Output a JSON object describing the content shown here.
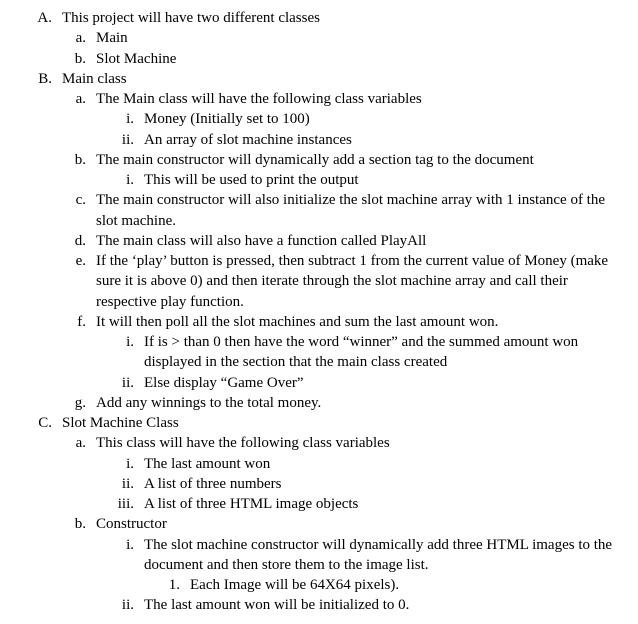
{
  "items": [
    {
      "level": 0,
      "marker": "A.",
      "text": "This project will have two different classes"
    },
    {
      "level": 1,
      "marker": "a.",
      "text": "Main"
    },
    {
      "level": 1,
      "marker": "b.",
      "text": "Slot Machine"
    },
    {
      "level": 0,
      "marker": "B.",
      "text": "Main class"
    },
    {
      "level": 1,
      "marker": "a.",
      "text": "The Main class will have the following class variables"
    },
    {
      "level": 2,
      "marker": "i.",
      "text": "Money (Initially set to 100)"
    },
    {
      "level": 2,
      "marker": "ii.",
      "text": "An array of slot machine instances"
    },
    {
      "level": 1,
      "marker": "b.",
      "text": "The main constructor will dynamically add a section tag to the document"
    },
    {
      "level": 2,
      "marker": "i.",
      "text": "This will be used to print the output"
    },
    {
      "level": 1,
      "marker": "c.",
      "text": "The main constructor will also initialize the slot machine array with 1 instance of the slot machine."
    },
    {
      "level": 1,
      "marker": "d.",
      "text": "The main class will also have a function called PlayAll"
    },
    {
      "level": 1,
      "marker": "e.",
      "text": "If the ‘play’ button is pressed, then subtract 1 from the current value of Money (make sure it is above 0) and then iterate through the slot machine array and call their respective play function."
    },
    {
      "level": 1,
      "marker": "f.",
      "text": "It will then poll all the slot machines and sum the last amount won."
    },
    {
      "level": 2,
      "marker": "i.",
      "text": "If is > than 0 then have the word “winner” and the summed amount won displayed in the section that the main class created"
    },
    {
      "level": 2,
      "marker": "ii.",
      "text": "Else display “Game Over”"
    },
    {
      "level": 1,
      "marker": "g.",
      "text": "Add any winnings to the total money."
    },
    {
      "level": 0,
      "marker": "C.",
      "text": "Slot Machine Class"
    },
    {
      "level": 1,
      "marker": "a.",
      "text": "This class will have the following class variables"
    },
    {
      "level": 2,
      "marker": "i.",
      "text": "The last amount won"
    },
    {
      "level": 2,
      "marker": "ii.",
      "text": "A list of three numbers"
    },
    {
      "level": 2,
      "marker": "iii.",
      "text": "A list of three HTML image objects"
    },
    {
      "level": 1,
      "marker": "b.",
      "text": "Constructor"
    },
    {
      "level": 2,
      "marker": "i.",
      "text": "The slot machine constructor will dynamically add three HTML images to the document and then store them to the image list."
    },
    {
      "level": 3,
      "marker": "1.",
      "text": "Each Image will be 64X64 pixels)."
    },
    {
      "level": 2,
      "marker": "ii.",
      "text": "The last amount won will be initialized to 0."
    }
  ]
}
